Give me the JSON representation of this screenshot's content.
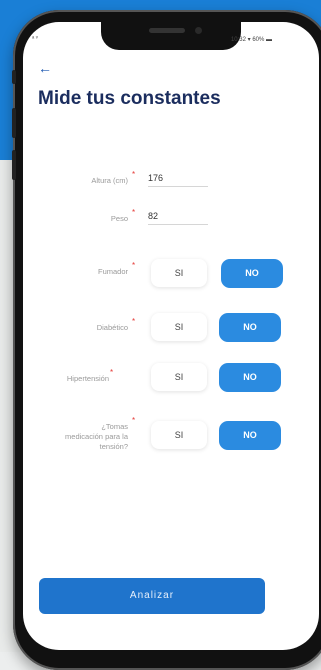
{
  "colors": {
    "top_background": "#1a7fd6",
    "accent": "#2b8be0",
    "title": "#1b2d5e",
    "required": "#e53935"
  },
  "status_bar": {
    "left": "ᵃ ᵛ",
    "right": "10:32 ▾ 60% ▬"
  },
  "header": {
    "back_icon": "back-arrow-icon",
    "back_glyph": "←",
    "title": "Mide tus constantes"
  },
  "form": {
    "required_mark": "*",
    "height": {
      "label": "Altura (cm)",
      "value": "176"
    },
    "weight": {
      "label": "Peso",
      "value": "82"
    },
    "questions": [
      {
        "label": "Fumador",
        "yes": "SI",
        "no": "NO",
        "selected": "NO"
      },
      {
        "label": "Diabético",
        "yes": "SI",
        "no": "NO",
        "selected": "NO"
      },
      {
        "label": "Hipertensión",
        "yes": "SI",
        "no": "NO",
        "selected": "NO"
      },
      {
        "label": "¿Tomas medicación para la tensión?",
        "yes": "SI",
        "no": "NO",
        "selected": "NO"
      }
    ]
  },
  "footer": {
    "analyze_label": "Analizar"
  }
}
